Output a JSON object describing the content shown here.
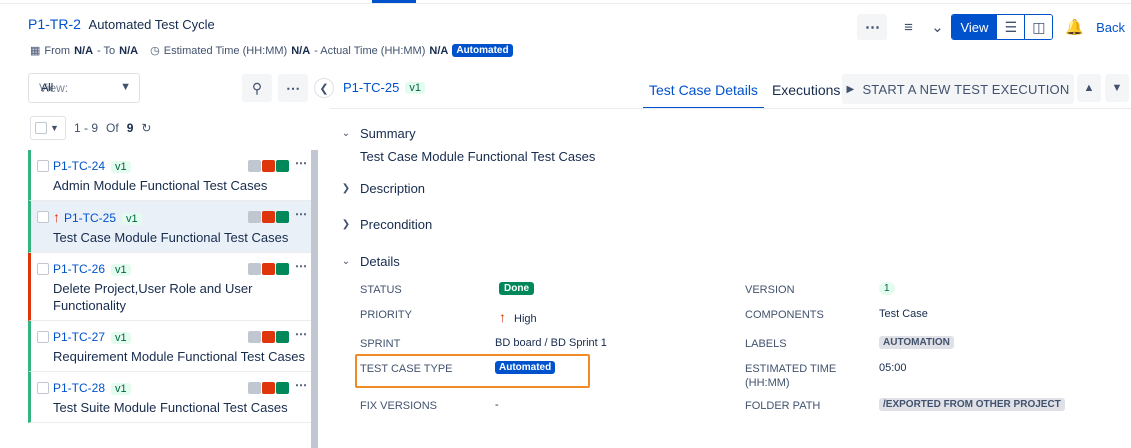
{
  "header": {
    "issue_key": "P1-TR-2",
    "title": "Automated Test Cycle",
    "from_label": "From",
    "from_value": "N/A",
    "to_label": "- To",
    "to_value": "N/A",
    "est_label": "Estimated Time (HH:MM)",
    "est_value": "N/A",
    "actual_label": "- Actual Time (HH:MM)",
    "actual_value": "N/A",
    "badge": "Automated",
    "view_label": "View",
    "back_label": "Back"
  },
  "left": {
    "view_prefix": "View",
    "view_value": "All",
    "page_range": "1 - 9",
    "of_label": "Of",
    "total": "9"
  },
  "cases": [
    {
      "key": "P1-TC-24",
      "version": "v1",
      "title": "Admin Module Functional Test Cases",
      "priority_high": false,
      "bar": "green"
    },
    {
      "key": "P1-TC-25",
      "version": "v1",
      "title": "Test Case Module Functional Test Cases",
      "priority_high": true,
      "bar": "green"
    },
    {
      "key": "P1-TC-26",
      "version": "v1",
      "title": "Delete Project,User Role and User Functionality",
      "priority_high": false,
      "bar": "red"
    },
    {
      "key": "P1-TC-27",
      "version": "v1",
      "title": "Requirement Module Functional Test Cases",
      "priority_high": false,
      "bar": "green"
    },
    {
      "key": "P1-TC-28",
      "version": "v1",
      "title": "Test Suite Module Functional Test Cases",
      "priority_high": false,
      "bar": "green"
    }
  ],
  "detail": {
    "key": "P1-TC-25",
    "version": "v1",
    "tab_details": "Test Case Details",
    "tab_executions": "Executions",
    "start_button": "START A NEW TEST EXECUTION",
    "sec_summary": "Summary",
    "summary_text": "Test Case Module Functional Test Cases",
    "sec_description": "Description",
    "sec_precondition": "Precondition",
    "sec_details": "Details",
    "fields": {
      "status_label": "STATUS",
      "status_value": "Done",
      "priority_label": "PRIORITY",
      "priority_value": "High",
      "sprint_label": "SPRINT",
      "sprint_value": "BD board / BD Sprint 1",
      "type_label": "TEST CASE TYPE",
      "type_value": "Automated",
      "fix_label": "FIX VERSIONS",
      "fix_value": "-",
      "version_label": "VERSION",
      "version_value": "1",
      "components_label": "COMPONENTS",
      "components_value": "Test Case",
      "labels_label": "LABELS",
      "labels_value": "AUTOMATION",
      "est_label_1": "ESTIMATED TIME",
      "est_label_2": "(HH:MM)",
      "est_value": "05:00",
      "folder_label": "FOLDER PATH",
      "folder_value": "/EXPORTED FROM OTHER PROJECT"
    }
  },
  "colors": {
    "accent": "#0052cc",
    "done": "#00875a",
    "pass": "#36b37e",
    "fail": "#de350b",
    "highlight": "#f08c28"
  }
}
